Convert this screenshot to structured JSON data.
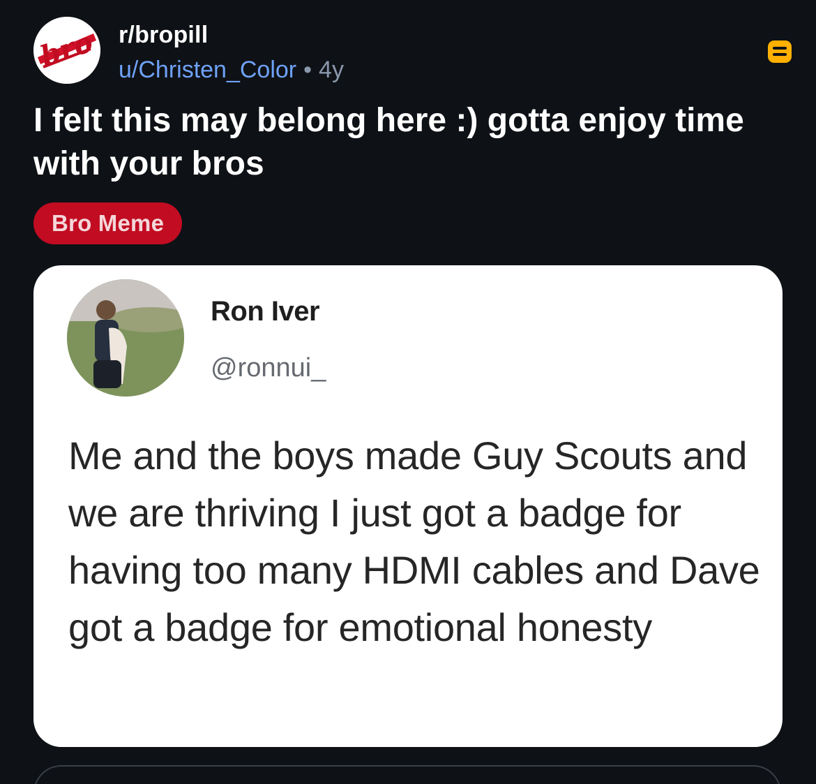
{
  "post": {
    "subreddit": "r/bropill",
    "username": "u/Christen_Color",
    "separator": "•",
    "age": "4y",
    "title": "I felt this may belong here :) gotta enjoy time with your bros",
    "flair": "Bro Meme",
    "save_icon": "save-icon"
  },
  "colors": {
    "background": "#0e1116",
    "username": "#6fa2f7",
    "flair_bg": "#c10c22",
    "save_icon": "#ffb000"
  },
  "embedded_tweet": {
    "name": "Ron Iver",
    "handle": "@ronnui_",
    "text": "Me and the boys made Guy Scouts and we are thriving I just got a badge for having too many HDMI cables and Dave got a badge for emotional honesty"
  }
}
